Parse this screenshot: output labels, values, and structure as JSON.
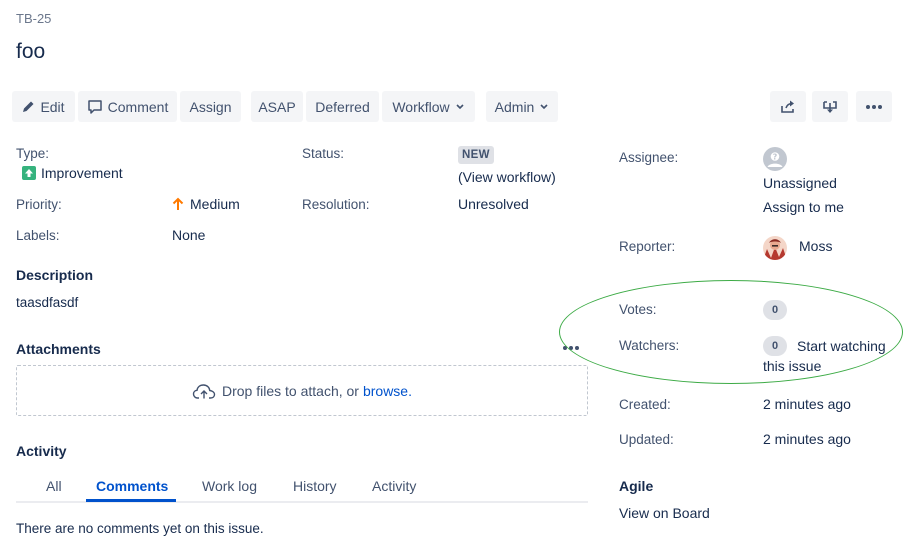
{
  "issue": {
    "key": "TB-25",
    "title": "foo"
  },
  "toolbar": {
    "edit": "Edit",
    "comment": "Comment",
    "assign": "Assign",
    "asap": "ASAP",
    "deferred": "Deferred",
    "workflow": "Workflow",
    "admin": "Admin"
  },
  "details": {
    "type_label": "Type:",
    "type_value": "Improvement",
    "status_label": "Status:",
    "status_value": "NEW",
    "view_workflow": "(View workflow)",
    "priority_label": "Priority:",
    "priority_value": "Medium",
    "resolution_label": "Resolution:",
    "resolution_value": "Unresolved",
    "labels_label": "Labels:",
    "labels_value": "None"
  },
  "description": {
    "heading": "Description",
    "text": "taasdfasdf"
  },
  "attachments": {
    "heading": "Attachments",
    "drop_text": "Drop files to attach, or",
    "browse_link": "browse."
  },
  "activity": {
    "heading": "Activity",
    "tabs": [
      "All",
      "Comments",
      "Work log",
      "History",
      "Activity"
    ],
    "active_tab": "Comments",
    "empty_text": "There are no comments yet on this issue."
  },
  "people": {
    "assignee_label": "Assignee:",
    "assignee_value": "Unassigned",
    "assign_to_me": "Assign to me",
    "reporter_label": "Reporter:",
    "reporter_value": "Moss",
    "votes_label": "Votes:",
    "votes_count": "0",
    "watchers_label": "Watchers:",
    "watchers_count": "0",
    "start_watching_1": "Start watching",
    "start_watching_2": "this issue"
  },
  "dates": {
    "created_label": "Created:",
    "created_value": "2 minutes ago",
    "updated_label": "Updated:",
    "updated_value": "2 minutes ago"
  },
  "agile": {
    "heading": "Agile",
    "view_on_board": "View on Board"
  },
  "colors": {
    "link": "#0052cc",
    "improvement_icon": "#36b37e",
    "priority_medium": "#ff7a00",
    "highlight_ring": "#3dab46"
  },
  "icons": [
    "pencil-icon",
    "comment-icon",
    "chevron-down-icon",
    "share-icon",
    "export-icon",
    "more-icon",
    "improvement-icon",
    "arrow-up-icon",
    "cloud-upload-icon",
    "avatar-unassigned-icon",
    "avatar-moss"
  ]
}
